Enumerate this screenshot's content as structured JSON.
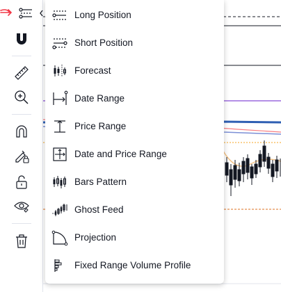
{
  "toolbar": {
    "tools": [
      {
        "name": "measure-tools-icon"
      },
      {
        "name": "magnet-icon"
      },
      {
        "name": "ruler-icon"
      },
      {
        "name": "zoom-in-icon"
      },
      {
        "name": "magnet-mode-icon"
      },
      {
        "name": "lock-drawing-icon"
      },
      {
        "name": "lock-icon"
      },
      {
        "name": "eye-icon"
      },
      {
        "name": "trash-icon"
      }
    ],
    "accent_color": "#f23645"
  },
  "menu": {
    "items": [
      {
        "label": "Long Position",
        "icon": "long-position-icon"
      },
      {
        "label": "Short Position",
        "icon": "short-position-icon"
      },
      {
        "label": "Forecast",
        "icon": "forecast-icon"
      },
      {
        "label": "Date Range",
        "icon": "date-range-icon"
      },
      {
        "label": "Price Range",
        "icon": "price-range-icon"
      },
      {
        "label": "Date and Price Range",
        "icon": "date-price-range-icon"
      },
      {
        "label": "Bars Pattern",
        "icon": "bars-pattern-icon"
      },
      {
        "label": "Ghost Feed",
        "icon": "ghost-feed-icon"
      },
      {
        "label": "Projection",
        "icon": "projection-icon"
      },
      {
        "label": "Fixed Range Volume Profile",
        "icon": "volume-profile-icon"
      }
    ]
  }
}
